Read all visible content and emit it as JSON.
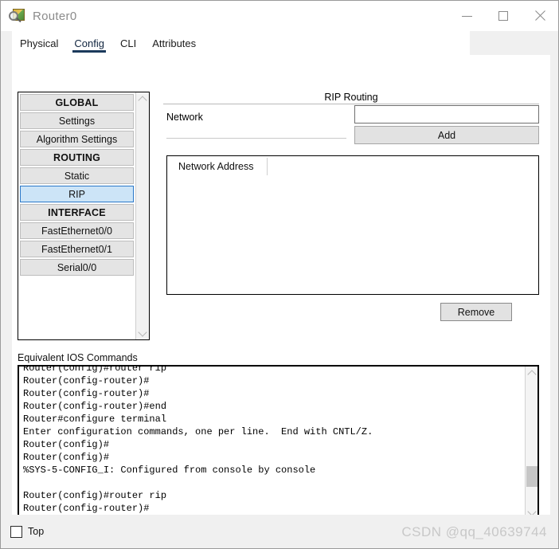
{
  "window": {
    "title": "Router0",
    "icon": "router-device-icon",
    "controls": {
      "minimize": "—",
      "maximize": "□",
      "close": "✕"
    }
  },
  "tabs": [
    {
      "label": "Physical",
      "selected": false
    },
    {
      "label": "Config",
      "selected": true
    },
    {
      "label": "CLI",
      "selected": false
    },
    {
      "label": "Attributes",
      "selected": false
    }
  ],
  "sidebar": {
    "items": [
      {
        "label": "GLOBAL",
        "type": "header"
      },
      {
        "label": "Settings",
        "type": "item"
      },
      {
        "label": "Algorithm Settings",
        "type": "item"
      },
      {
        "label": "ROUTING",
        "type": "header"
      },
      {
        "label": "Static",
        "type": "item"
      },
      {
        "label": "RIP",
        "type": "item",
        "selected": true
      },
      {
        "label": "INTERFACE",
        "type": "header"
      },
      {
        "label": "FastEthernet0/0",
        "type": "item"
      },
      {
        "label": "FastEthernet0/1",
        "type": "item"
      },
      {
        "label": "Serial0/0",
        "type": "item"
      }
    ],
    "scroll_up": "chevron-up",
    "scroll_down": "chevron-down"
  },
  "rip_panel": {
    "group_title": "RIP Routing",
    "network_label": "Network",
    "network_value": "",
    "network_placeholder": "",
    "add_label": "Add",
    "table_header": "Network Address",
    "table_rows": [],
    "remove_label": "Remove"
  },
  "ios": {
    "label": "Equivalent IOS Commands",
    "lines": [
      "Router(config)#router rip",
      "Router(config-router)#",
      "Router(config-router)#",
      "Router(config-router)#end",
      "Router#configure terminal",
      "Enter configuration commands, one per line.  End with CNTL/Z.",
      "Router(config)#",
      "Router(config)#",
      "%SYS-5-CONFIG_I: Configured from console by console",
      "",
      "Router(config)#router rip",
      "Router(config-router)#"
    ]
  },
  "bottom": {
    "top_checkbox_label": "Top",
    "top_checked": false,
    "watermark": "CSDN @qq_40639744"
  },
  "colors": {
    "selection_bg": "#cce4f7",
    "selection_border": "#2a77c8",
    "tab_underline": "#1b3a5c",
    "button_bg": "#e2e2e2",
    "panel_bg": "#f0f0f0",
    "watermark": "#c8c8c8"
  }
}
